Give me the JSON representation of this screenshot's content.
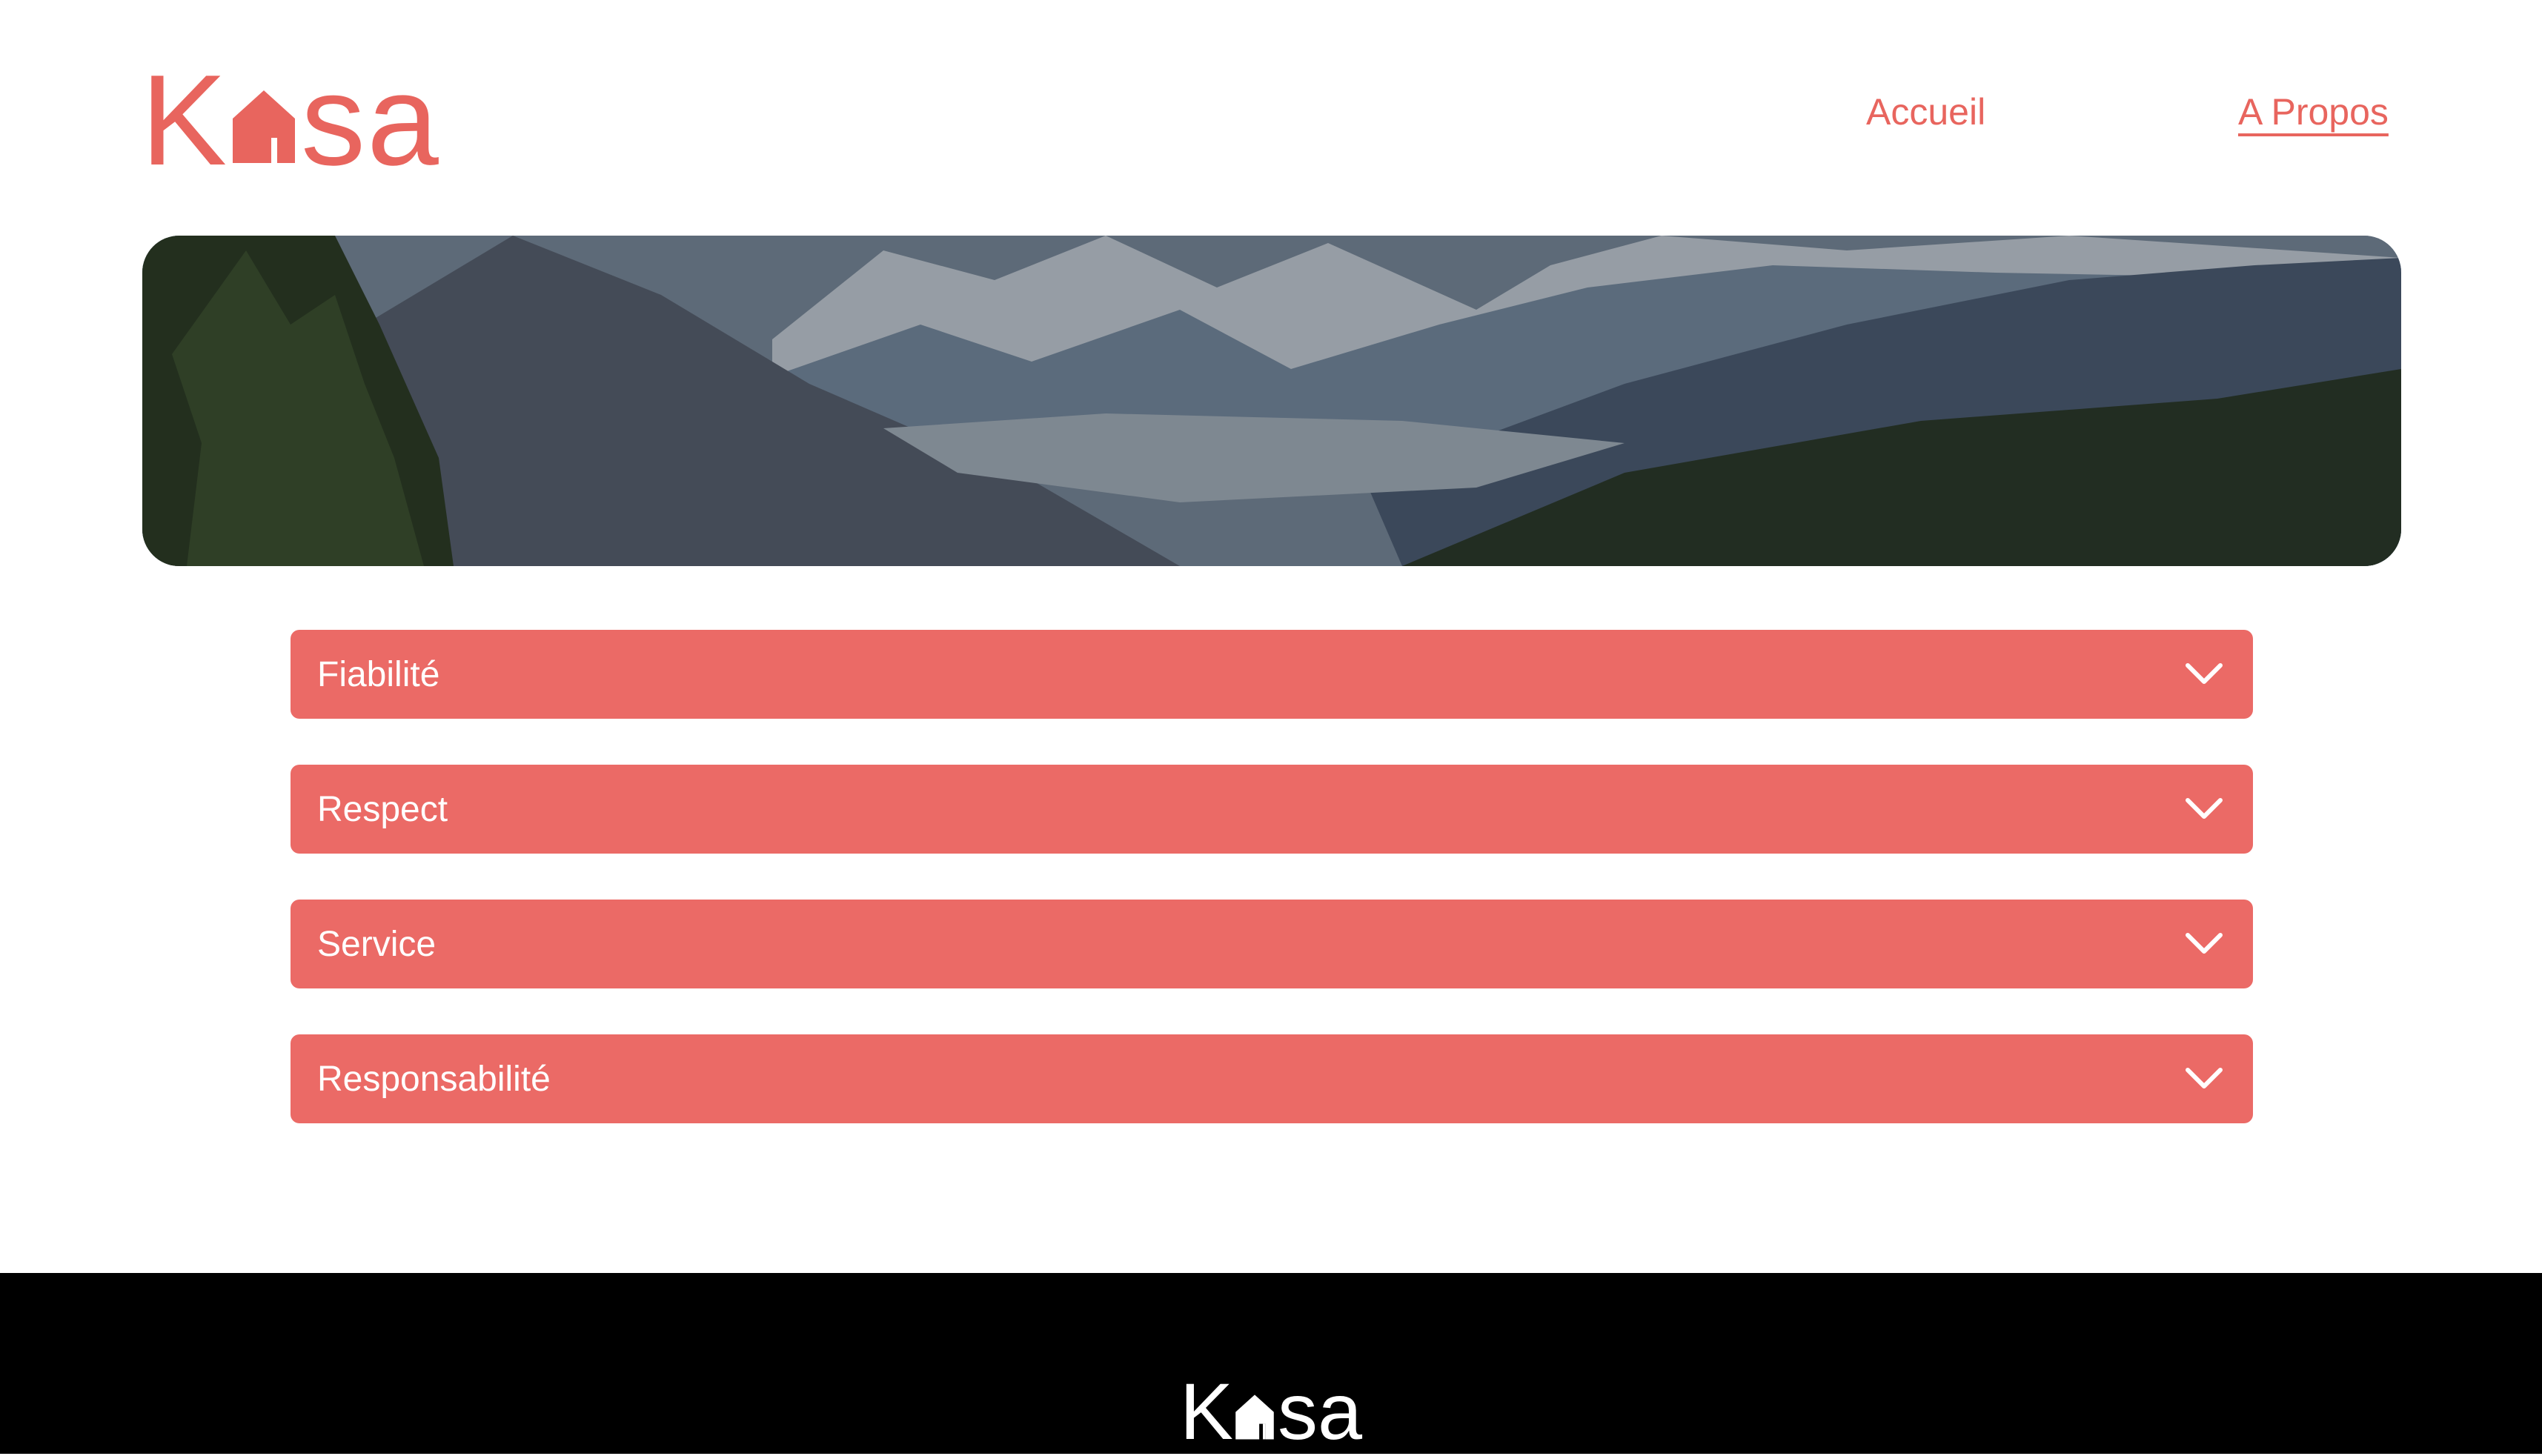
{
  "brand": {
    "name_left": "K",
    "name_right": "sa",
    "color": "#E8655E"
  },
  "nav": {
    "home_label": "Accueil",
    "about_label": "A Propos"
  },
  "banner": {
    "alt": "Mountain valley landscape"
  },
  "sections": [
    {
      "label": "Fiabilité"
    },
    {
      "label": "Respect"
    },
    {
      "label": "Service"
    },
    {
      "label": "Responsabilité"
    }
  ],
  "footer": {
    "brand_left": "K",
    "brand_right": "sa"
  },
  "colors": {
    "accent": "#EB6A66",
    "footer_bg": "#000000"
  }
}
